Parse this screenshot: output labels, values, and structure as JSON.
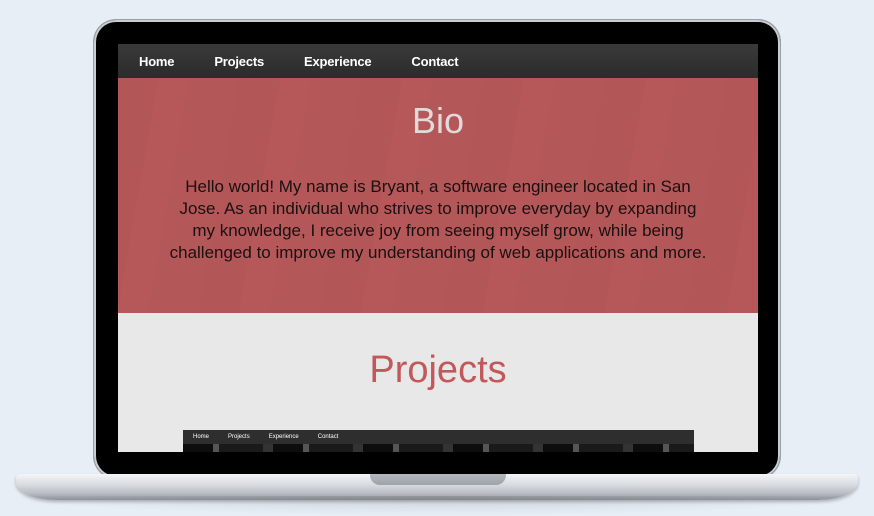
{
  "nav": {
    "items": [
      {
        "label": "Home"
      },
      {
        "label": "Projects"
      },
      {
        "label": "Experience"
      },
      {
        "label": "Contact"
      }
    ]
  },
  "bio": {
    "title": "Bio",
    "text": "Hello world! My name is Bryant, a software engineer located in San Jose. As an individual who strives to improve everyday by expanding my knowledge, I receive joy from seeing myself grow, while being challenged to improve my understanding of web applications and more."
  },
  "projects": {
    "title": "Projects",
    "thumbnail_nav": [
      "Home",
      "Projects",
      "Experience",
      "Contact"
    ]
  },
  "colors": {
    "accent": "#c2585a",
    "bio_bg": "#b8585a",
    "nav_bg": "#2f2f2f"
  }
}
